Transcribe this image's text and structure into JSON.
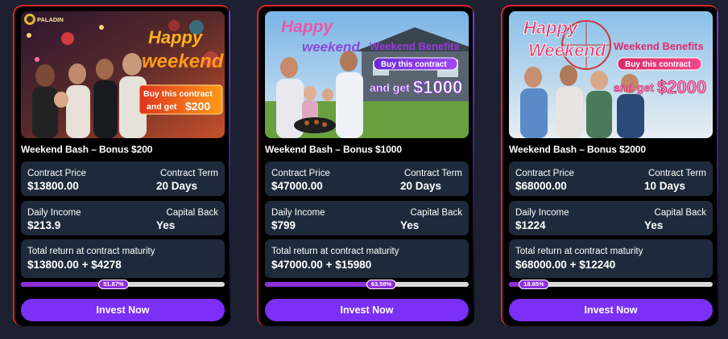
{
  "accent": "#7b2ff7",
  "progress_color": "#8e2fd8",
  "cards": [
    {
      "logo_text": "PALADIN",
      "banner": {
        "headline_1": "Happy",
        "headline_2": "weekend",
        "cta_1": "Buy this contract",
        "cta_2": "and get",
        "amount": "$200"
      },
      "title": "Weekend Bash – Bonus $200",
      "contract_price_label": "Contract Price",
      "contract_price": "$13800.00",
      "contract_term_label": "Contract Term",
      "contract_term": "20 Days",
      "daily_income_label": "Daily Income",
      "daily_income": "$213.9",
      "capital_back_label": "Capital Back",
      "capital_back": "Yes",
      "total_return_label": "Total return at contract maturity",
      "total_return": "$13800.00 + $4278",
      "progress_text": "51.87%",
      "progress_value": 51.87,
      "invest_label": "Invest Now"
    },
    {
      "banner": {
        "headline_1": "Happy",
        "headline_2": "weekend",
        "benefits": "Weekend Benefits",
        "cta_1": "Buy this contract",
        "cta_2": "and get",
        "amount": "$1000"
      },
      "title": "Weekend Bash – Bonus $1000",
      "contract_price_label": "Contract Price",
      "contract_price": "$47000.00",
      "contract_term_label": "Contract Term",
      "contract_term": "20 Days",
      "daily_income_label": "Daily Income",
      "daily_income": "$799",
      "capital_back_label": "Capital Back",
      "capital_back": "Yes",
      "total_return_label": "Total return at contract maturity",
      "total_return": "$47000.00 + $15980",
      "progress_text": "63.58%",
      "progress_value": 63.58,
      "invest_label": "Invest Now"
    },
    {
      "banner": {
        "headline_1": "Happy",
        "headline_2": "Weekend",
        "benefits": "Weekend Benefits",
        "cta_1": "Buy this contract",
        "cta_2": "and get",
        "amount": "$2000"
      },
      "title": "Weekend Bash – Bonus $2000",
      "contract_price_label": "Contract Price",
      "contract_price": "$68000.00",
      "contract_term_label": "Contract Term",
      "contract_term": "10 Days",
      "daily_income_label": "Daily Income",
      "daily_income": "$1224",
      "capital_back_label": "Capital Back",
      "capital_back": "Yes",
      "total_return_label": "Total return at contract maturity",
      "total_return": "$68000.00 + $12240",
      "progress_text": "18.65%",
      "progress_value": 18.65,
      "invest_label": "Invest Now"
    }
  ]
}
